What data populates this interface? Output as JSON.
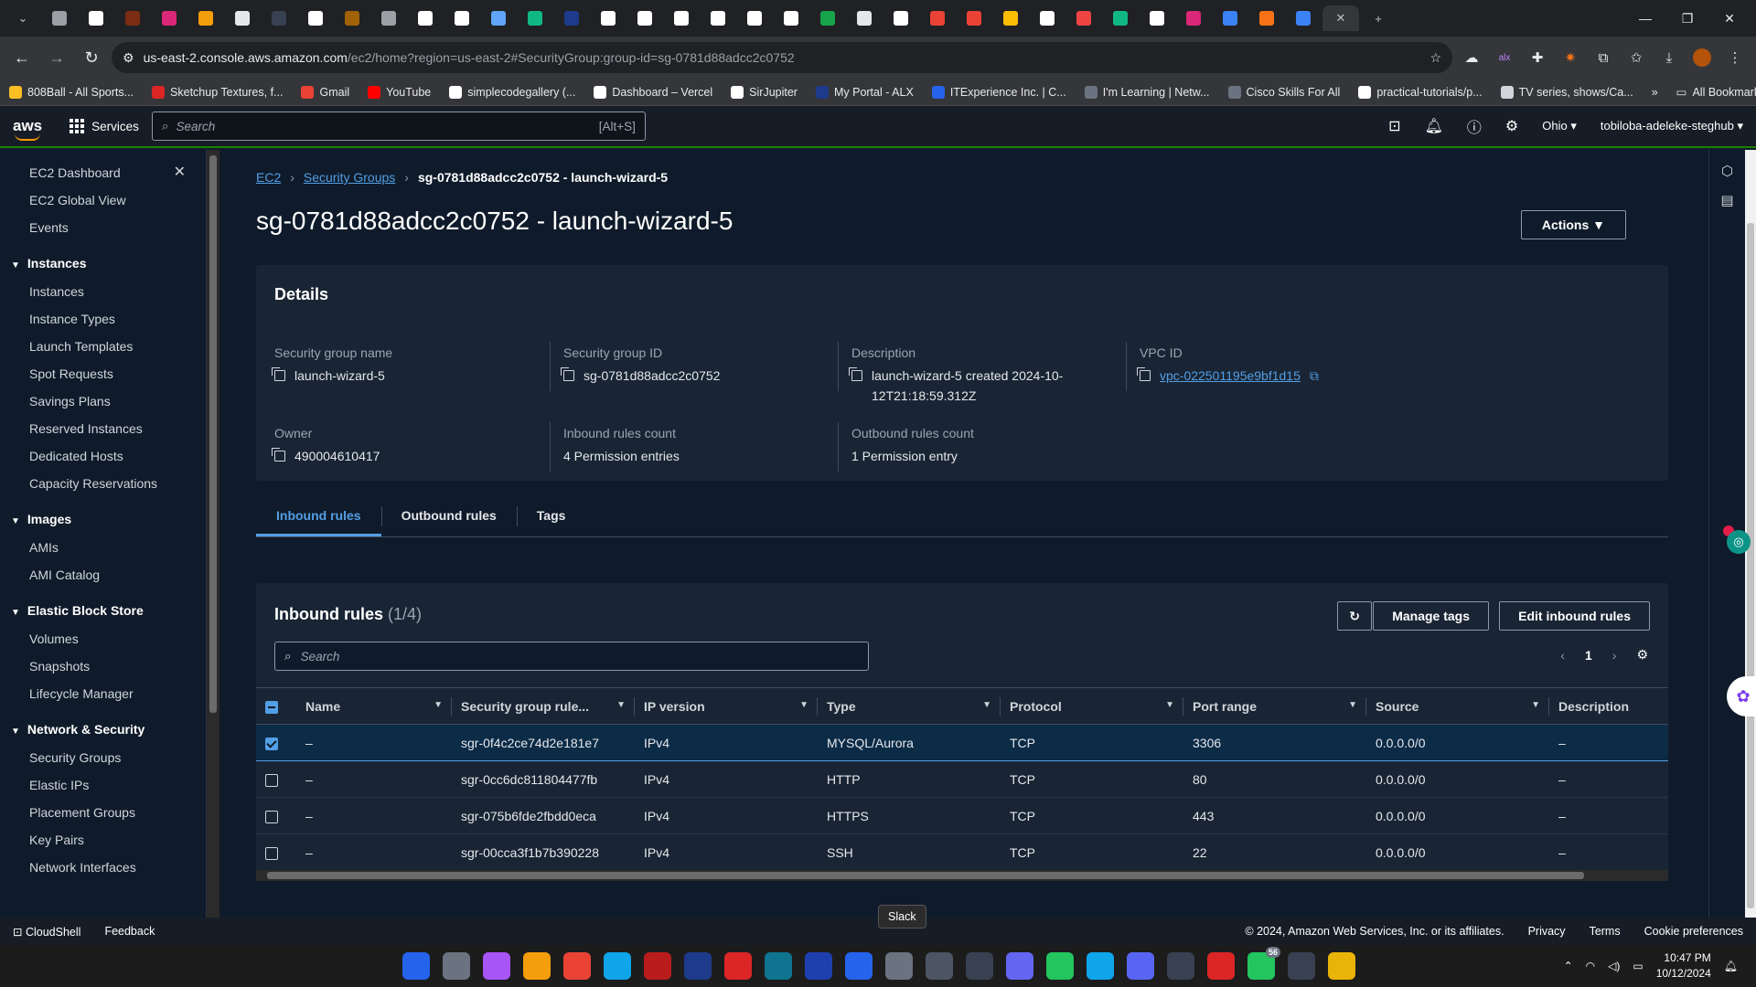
{
  "browser": {
    "url_host": "us-east-2.console.aws.amazon.com",
    "url_path": "/ec2/home?region=us-east-2#SecurityGroup:group-id=sg-0781d88adcc2c0752",
    "bookmarks": [
      "808Ball - All Sports...",
      "Sketchup Textures, f...",
      "Gmail",
      "YouTube",
      "simplecodegallery (...",
      "Dashboard – Vercel",
      "SirJupiter",
      "My Portal - ALX",
      "ITExperience Inc. | C...",
      "I'm Learning | Netw...",
      "Cisco Skills For All",
      "practical-tutorials/p...",
      "TV series, shows/Ca..."
    ],
    "all_bookmarks": "All Bookmarks"
  },
  "aws": {
    "logo": "aws",
    "services": "Services",
    "search_placeholder": "Search",
    "search_shortcut": "[Alt+S]",
    "region": "Ohio ▾",
    "account": "tobiloba-adeleke-steghub ▾"
  },
  "sidebar": {
    "top": [
      "EC2 Dashboard",
      "EC2 Global View",
      "Events"
    ],
    "sections": [
      {
        "title": "Instances",
        "items": [
          "Instances",
          "Instance Types",
          "Launch Templates",
          "Spot Requests",
          "Savings Plans",
          "Reserved Instances",
          "Dedicated Hosts",
          "Capacity Reservations"
        ]
      },
      {
        "title": "Images",
        "items": [
          "AMIs",
          "AMI Catalog"
        ]
      },
      {
        "title": "Elastic Block Store",
        "items": [
          "Volumes",
          "Snapshots",
          "Lifecycle Manager"
        ]
      },
      {
        "title": "Network & Security",
        "items": [
          "Security Groups",
          "Elastic IPs",
          "Placement Groups",
          "Key Pairs",
          "Network Interfaces"
        ]
      }
    ]
  },
  "breadcrumb": {
    "ec2": "EC2",
    "sgs": "Security Groups",
    "current": "sg-0781d88adcc2c0752 - launch-wizard-5"
  },
  "page_title": "sg-0781d88adcc2c0752 - launch-wizard-5",
  "actions_label": "Actions ▼",
  "details": {
    "heading": "Details",
    "sg_name_label": "Security group name",
    "sg_name": "launch-wizard-5",
    "sg_id_label": "Security group ID",
    "sg_id": "sg-0781d88adcc2c0752",
    "desc_label": "Description",
    "desc": "launch-wizard-5 created 2024-10-12T21:18:59.312Z",
    "vpc_label": "VPC ID",
    "vpc": "vpc-022501195e9bf1d15",
    "owner_label": "Owner",
    "owner": "490004610417",
    "in_count_label": "Inbound rules count",
    "in_count": "4 Permission entries",
    "out_count_label": "Outbound rules count",
    "out_count": "1 Permission entry"
  },
  "tabs": [
    "Inbound rules",
    "Outbound rules",
    "Tags"
  ],
  "rules": {
    "title": "Inbound rules",
    "count": "(1/4)",
    "manage_tags": "Manage tags",
    "edit": "Edit inbound rules",
    "search_placeholder": "Search",
    "page": "1",
    "columns": [
      "Name",
      "Security group rule...",
      "IP version",
      "Type",
      "Protocol",
      "Port range",
      "Source",
      "Description"
    ],
    "rows": [
      {
        "name": "–",
        "id": "sgr-0f4c2ce74d2e181e7",
        "ipv": "IPv4",
        "type": "MYSQL/Aurora",
        "proto": "TCP",
        "port": "3306",
        "src": "0.0.0.0/0",
        "desc": "–",
        "selected": true
      },
      {
        "name": "–",
        "id": "sgr-0cc6dc811804477fb",
        "ipv": "IPv4",
        "type": "HTTP",
        "proto": "TCP",
        "port": "80",
        "src": "0.0.0.0/0",
        "desc": "–",
        "selected": false
      },
      {
        "name": "–",
        "id": "sgr-075b6fde2fbdd0eca",
        "ipv": "IPv4",
        "type": "HTTPS",
        "proto": "TCP",
        "port": "443",
        "src": "0.0.0.0/0",
        "desc": "–",
        "selected": false
      },
      {
        "name": "–",
        "id": "sgr-00cca3f1b7b390228",
        "ipv": "IPv4",
        "type": "SSH",
        "proto": "TCP",
        "port": "22",
        "src": "0.0.0.0/0",
        "desc": "–",
        "selected": false
      }
    ]
  },
  "footer": {
    "cloudshell": "CloudShell",
    "feedback": "Feedback",
    "copyright": "© 2024, Amazon Web Services, Inc. or its affiliates.",
    "privacy": "Privacy",
    "terms": "Terms",
    "cookies": "Cookie preferences"
  },
  "tooltip": "Slack",
  "taskbar": {
    "time": "10:47 PM",
    "date": "10/12/2024",
    "whatsapp_badge": "56"
  }
}
